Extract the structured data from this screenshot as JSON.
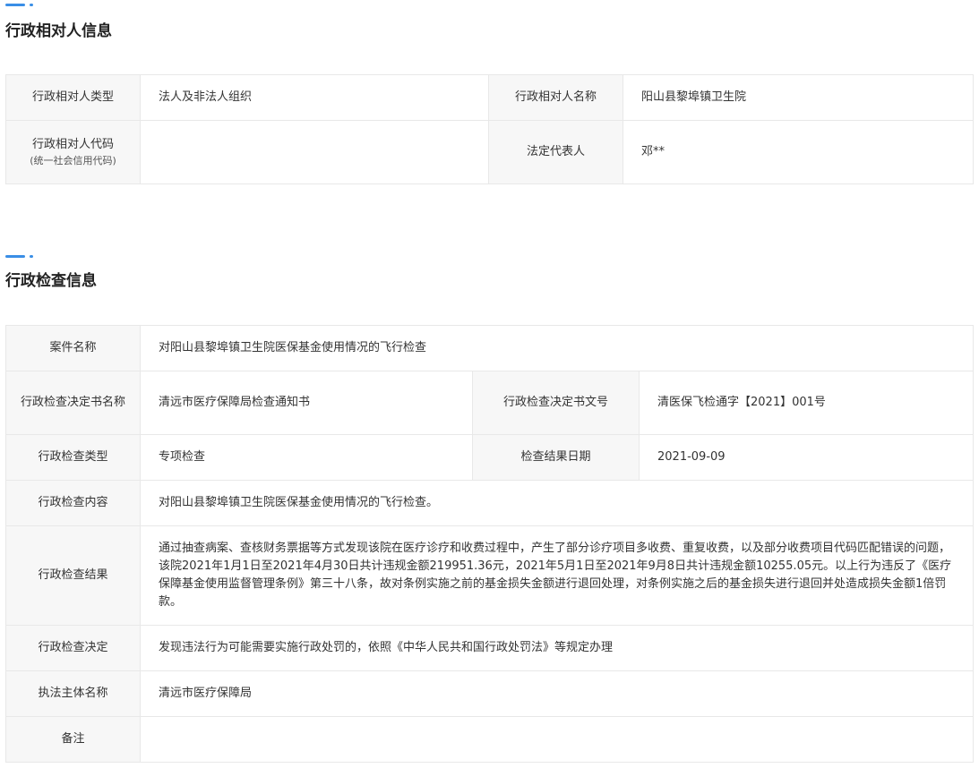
{
  "section1": {
    "title": "行政相对人信息",
    "rows": [
      {
        "label_a": "行政相对人类型",
        "value_a": "法人及非法人组织",
        "label_b": "行政相对人名称",
        "value_b": "阳山县黎埠镇卫生院"
      },
      {
        "label_a": "行政相对人代码",
        "label_a_sub": "(统一社会信用代码)",
        "value_a": "",
        "label_b": "法定代表人",
        "value_b": "邓**"
      }
    ]
  },
  "section2": {
    "title": "行政检查信息",
    "case_name": {
      "label": "案件名称",
      "value": "对阳山县黎埠镇卫生院医保基金使用情况的飞行检查"
    },
    "decision_doc": {
      "label": "行政检查决定书名称",
      "value": "清远市医疗保障局检查通知书",
      "label_b": "行政检查决定书文号",
      "value_b": "清医保飞检通字【2021】001号"
    },
    "check_type": {
      "label": "行政检查类型",
      "value": "专项检查",
      "label_b": "检查结果日期",
      "value_b": "2021-09-09"
    },
    "check_content": {
      "label": "行政检查内容",
      "value": "对阳山县黎埠镇卫生院医保基金使用情况的飞行检查。"
    },
    "check_result": {
      "label": "行政检查结果",
      "value": "通过抽查病案、查核财务票据等方式发现该院在医疗诊疗和收费过程中，产生了部分诊疗项目多收费、重复收费，以及部分收费项目代码匹配错误的问题，该院2021年1月1日至2021年4月30日共计违规金额219951.36元，2021年5月1日至2021年9月8日共计违规金额10255.05元。以上行为违反了《医疗保障基金使用监督管理条例》第三十八条，故对条例实施之前的基金损失金额进行退回处理，对条例实施之后的基金损失进行退回并处造成损失金额1倍罚款。"
    },
    "check_decision": {
      "label": "行政检查决定",
      "value": "发现违法行为可能需要实施行政处罚的，依照《中华人民共和国行政处罚法》等规定办理"
    },
    "enforcer": {
      "label": "执法主体名称",
      "value": "清远市医疗保障局"
    },
    "remark": {
      "label": "备注",
      "value": ""
    }
  },
  "colors": {
    "accent": "#3a8ee6",
    "label_bg": "#f7f7f7",
    "border": "#e8e8e8"
  }
}
